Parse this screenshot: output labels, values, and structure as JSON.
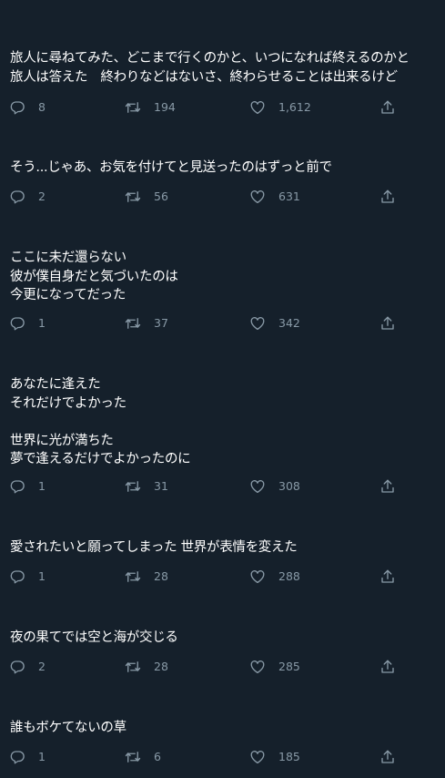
{
  "tweets": [
    {
      "lines": [
        "旅人に尋ねてみた、どこまで行くのかと、いつになれば終えるのかと",
        "旅人は答えた　終わりなどはないさ、終わらせることは出来るけど"
      ],
      "replies": "8",
      "retweets": "194",
      "likes": "1,612"
    },
    {
      "lines": [
        "そう...じゃあ、お気を付けてと見送ったのはずっと前で"
      ],
      "replies": "2",
      "retweets": "56",
      "likes": "631"
    },
    {
      "lines": [
        "ここに未だ還らない",
        "彼が僕自身だと気づいたのは",
        "今更になってだった"
      ],
      "replies": "1",
      "retweets": "37",
      "likes": "342"
    },
    {
      "lines": [
        "あなたに逢えた",
        "それだけでよかった",
        "",
        "世界に光が満ちた",
        "夢で逢えるだけでよかったのに"
      ],
      "replies": "1",
      "retweets": "31",
      "likes": "308"
    },
    {
      "lines": [
        "愛されたいと願ってしまった 世界が表情を変えた"
      ],
      "replies": "1",
      "retweets": "28",
      "likes": "288"
    },
    {
      "lines": [
        "夜の果てでは空と海が交じる"
      ],
      "replies": "2",
      "retweets": "28",
      "likes": "285"
    },
    {
      "lines": [
        "誰もボケてないの草"
      ],
      "replies": "1",
      "retweets": "6",
      "likes": "185"
    }
  ],
  "icons": {
    "reply": "reply-icon",
    "retweet": "retweet-icon",
    "like": "like-icon",
    "share": "share-icon"
  },
  "colors": {
    "background": "#15202b",
    "text": "#ffffff",
    "secondary": "#8899a6"
  }
}
